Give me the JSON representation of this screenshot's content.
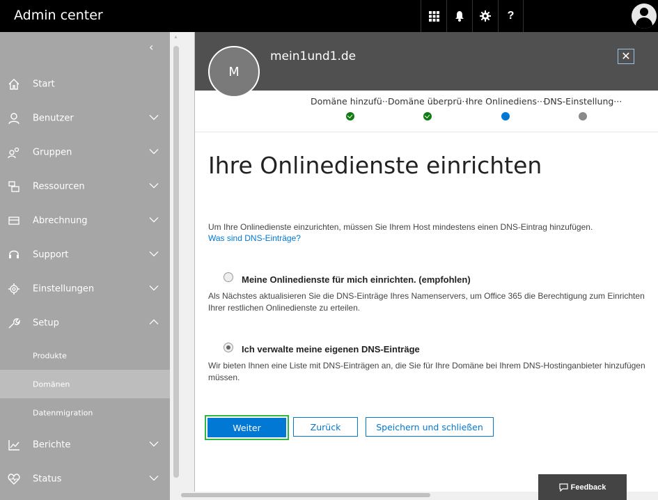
{
  "topbar": {
    "title": "Admin center",
    "icons": [
      "app-launcher-icon",
      "bell-icon",
      "gear-icon",
      "help-icon"
    ],
    "help_glyph": "?"
  },
  "sidebar": {
    "collapse_glyph": "‹",
    "items": [
      {
        "label": "Start",
        "icon": "home-icon",
        "chevron": false
      },
      {
        "label": "Benutzer",
        "icon": "user-icon",
        "chevron": "down"
      },
      {
        "label": "Gruppen",
        "icon": "groups-icon",
        "chevron": "down"
      },
      {
        "label": "Ressourcen",
        "icon": "resources-icon",
        "chevron": "down"
      },
      {
        "label": "Abrechnung",
        "icon": "billing-icon",
        "chevron": "down"
      },
      {
        "label": "Support",
        "icon": "headset-icon",
        "chevron": "down"
      },
      {
        "label": "Einstellungen",
        "icon": "settings-icon",
        "chevron": "down"
      },
      {
        "label": "Setup",
        "icon": "wrench-icon",
        "chevron": "up"
      }
    ],
    "sub_items": [
      {
        "label": "Produkte",
        "active": false
      },
      {
        "label": "Domänen",
        "active": true
      },
      {
        "label": "Datenmigration",
        "active": false
      }
    ],
    "bottom_items": [
      {
        "label": "Berichte",
        "icon": "chart-icon",
        "chevron": "down"
      },
      {
        "label": "Status",
        "icon": "heart-icon",
        "chevron": "down"
      }
    ]
  },
  "panel": {
    "avatar_letter": "M",
    "domain": "mein1und1.de",
    "close_glyph": "✕",
    "steps": [
      {
        "label": "Domäne hinzufü···",
        "state": "done"
      },
      {
        "label": "Domäne überprü···",
        "state": "done"
      },
      {
        "label": "Ihre Onlinediens···",
        "state": "current"
      },
      {
        "label": "DNS-Einstellung···",
        "state": "todo"
      }
    ],
    "title": "Ihre Onlinedienste einrichten",
    "intro": "Um Ihre Onlinedienste einzurichten, müssen Sie Ihrem Host mindestens einen DNS-Eintrag hinzufügen.",
    "intro_link": "Was sind DNS-Einträge?",
    "options": [
      {
        "label": "Meine Onlinedienste für mich einrichten. (empfohlen)",
        "desc": "Als Nächstes aktualisieren Sie die DNS-Einträge Ihres Namenservers, um Office 365 die Berechtigung zum Einrichten Ihrer restlichen Onlinedienste zu erteilen.",
        "selected": false
      },
      {
        "label": "Ich verwalte meine eigenen DNS-Einträge",
        "desc": "Wir bieten Ihnen eine Liste mit DNS-Einträgen an, die Sie für Ihre Domäne bei Ihrem DNS-Hostinganbieter hinzufügen müssen.",
        "selected": true
      }
    ],
    "buttons": {
      "next": "Weiter",
      "back": "Zurück",
      "save_close": "Speichern und schließen"
    }
  },
  "feedback": {
    "label": "Feedback",
    "icon": "comment-icon"
  },
  "colors": {
    "accent": "#0078d4",
    "done": "#107c10",
    "highlight": "#2db742",
    "sidebar": "#a6a6a6"
  }
}
